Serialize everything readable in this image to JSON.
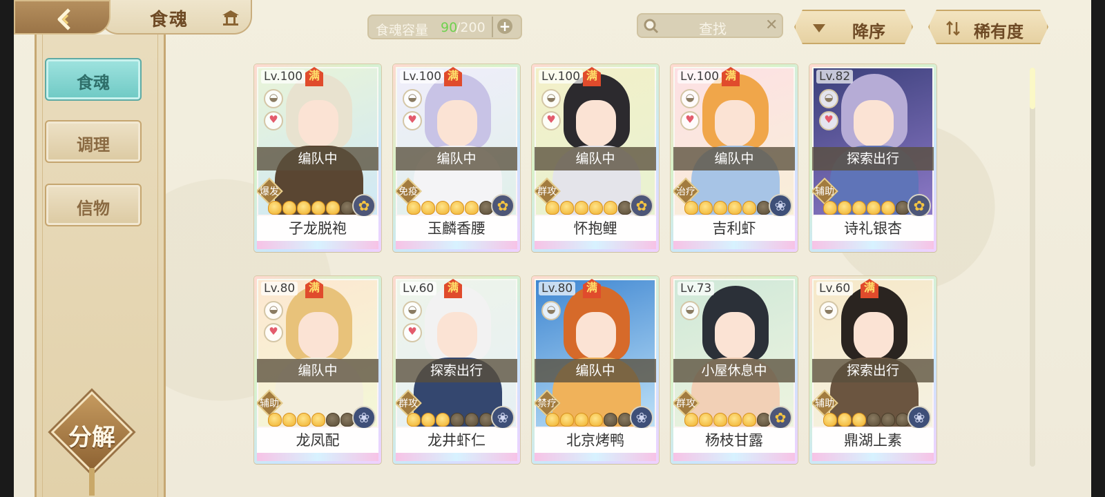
{
  "header": {
    "title": "食魂"
  },
  "capacity": {
    "label": "食魂容量",
    "current": "90",
    "max": "/200"
  },
  "search": {
    "placeholder": "查找"
  },
  "sort": {
    "order_label": "降序",
    "rarity_label": "稀有度"
  },
  "sidebar": {
    "items": [
      {
        "label": "食魂",
        "active": true
      },
      {
        "label": "调理",
        "active": false
      },
      {
        "label": "信物",
        "active": false
      }
    ],
    "decompose_label": "分解"
  },
  "cards": [
    {
      "level": "Lv.100",
      "max": "满",
      "status": "编队中",
      "role": "爆发",
      "stars": 5,
      "name": "子龙脱袍",
      "has_heart": true,
      "elem": "gold"
    },
    {
      "level": "Lv.100",
      "max": "满",
      "status": "编队中",
      "role": "免疫",
      "stars": 5,
      "name": "玉麟香腰",
      "has_heart": true,
      "elem": "gold"
    },
    {
      "level": "Lv.100",
      "max": "满",
      "status": "编队中",
      "role": "群攻",
      "stars": 5,
      "name": "怀抱鲤",
      "has_heart": true,
      "elem": "gold"
    },
    {
      "level": "Lv.100",
      "max": "满",
      "status": "编队中",
      "role": "治疗",
      "stars": 5,
      "name": "吉利虾",
      "has_heart": true,
      "elem": "blue"
    },
    {
      "level": "Lv.82",
      "max": "",
      "status": "探索出行",
      "role": "辅助",
      "stars": 5,
      "name": "诗礼银杏",
      "has_heart": true,
      "elem": "gold"
    },
    {
      "level": "Lv.80",
      "max": "满",
      "status": "编队中",
      "role": "辅助",
      "stars": 4,
      "name": "龙凤配",
      "has_heart": true,
      "elem": "blue"
    },
    {
      "level": "Lv.60",
      "max": "满",
      "status": "探索出行",
      "role": "群攻",
      "stars": 3,
      "name": "龙井虾仁",
      "has_heart": true,
      "elem": "blue"
    },
    {
      "level": "Lv.80",
      "max": "满",
      "status": "编队中",
      "role": "禁疗",
      "stars": 4,
      "name": "北京烤鸭",
      "has_heart": false,
      "elem": "blue"
    },
    {
      "level": "Lv.73",
      "max": "",
      "status": "小屋休息中",
      "role": "群攻",
      "stars": 5,
      "name": "杨枝甘露",
      "has_heart": false,
      "elem": "gold"
    },
    {
      "level": "Lv.60",
      "max": "满",
      "status": "探索出行",
      "role": "辅助",
      "stars": 3,
      "name": "鼎湖上素",
      "has_heart": false,
      "elem": "blue"
    }
  ],
  "colors": {
    "capacity_current": "#6fd14f",
    "active_tab": "#7fd6d1",
    "brand_brown": "#6e4a25"
  }
}
